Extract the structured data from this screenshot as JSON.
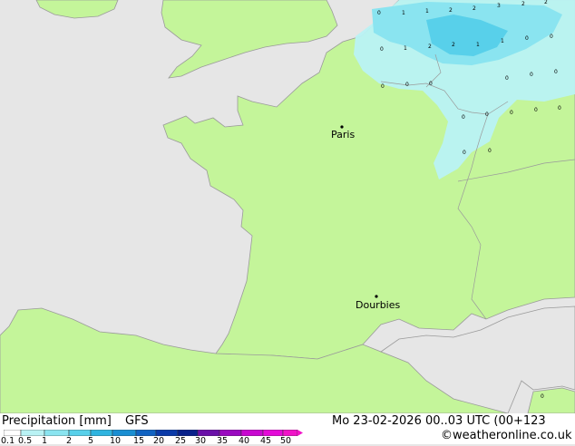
{
  "title": "Precipitation [mm]",
  "model": "GFS",
  "datetime": "Mo 23-02-2026 00..03 UTC (00+123",
  "credit": "©weatheronline.co.uk",
  "legend": {
    "ticks": [
      "0.1",
      "0.5",
      "1",
      "2",
      "5",
      "10",
      "15",
      "20",
      "25",
      "30",
      "35",
      "40",
      "45",
      "50"
    ],
    "colors": [
      "#ffffff",
      "#b9f2f4",
      "#8ae4f0",
      "#58d0ea",
      "#2fb4e0",
      "#1a8ed2",
      "#1163c2",
      "#0b3aa8",
      "#08208a",
      "#6a10a8",
      "#9a0ac0",
      "#c808d0",
      "#e40ad8",
      "#f014c8"
    ]
  },
  "cities": [
    {
      "name": "Paris"
    },
    {
      "name": "Dourbies"
    }
  ],
  "values": [
    "0",
    "1",
    "1",
    "2",
    "2",
    "3",
    "2",
    "2",
    "0",
    "1",
    "2",
    "2",
    "1",
    "0",
    "0",
    "0",
    "0",
    "0",
    "0",
    "0",
    "0",
    "0",
    "0",
    "0",
    "0",
    "0",
    "0",
    "1",
    "0",
    "0"
  ],
  "colors": {
    "land": "#c4f59a",
    "sea": "#e6e6e6",
    "light_precip": "#b9f2f4",
    "mid_precip": "#8ae4f0",
    "heavy_precip": "#58d0ea"
  }
}
